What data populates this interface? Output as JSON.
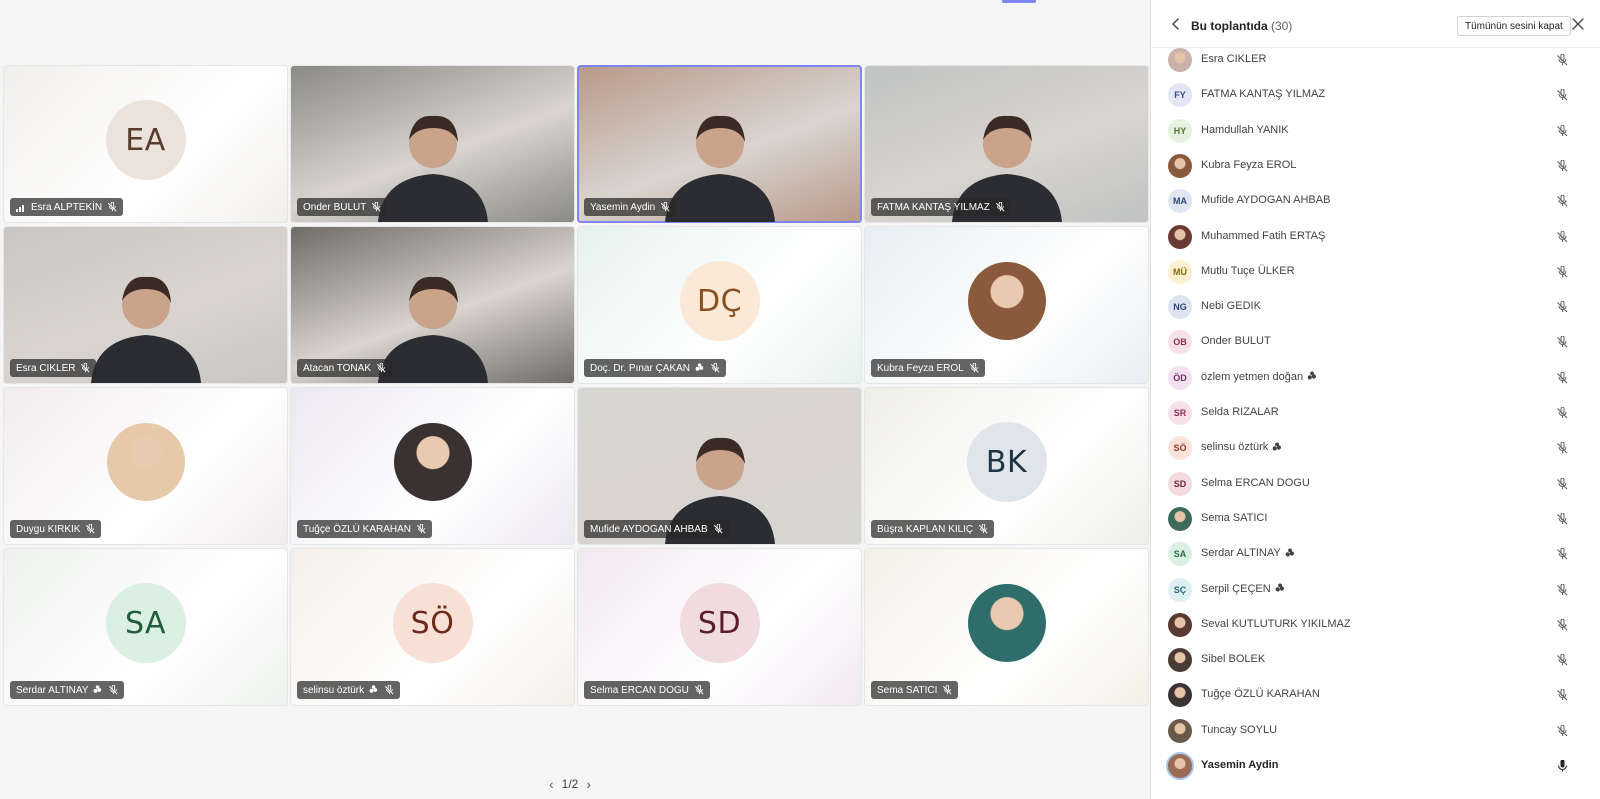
{
  "stage": {
    "tiles": [
      {
        "name": "Esra ALPTEKİN",
        "kind": "initials",
        "initials": "EA",
        "bg": "#f1efec",
        "avatar_bg": "#ece2dc",
        "avatar_fg": "#5a3c2e",
        "signal": true
      },
      {
        "name": "Onder BULUT",
        "kind": "video",
        "bg": "#8b8a86"
      },
      {
        "name": "Yasemin Aydin",
        "kind": "video",
        "bg": "#b99a8a",
        "active": true
      },
      {
        "name": "FATMA KANTAŞ YILMAZ",
        "kind": "video",
        "bg": "#bfc3c2"
      },
      {
        "name": "Esra CIKLER",
        "kind": "video",
        "bg": "#c9c6c4"
      },
      {
        "name": "Atacan TONAK",
        "kind": "video",
        "bg": "#6f6b66"
      },
      {
        "name": "Doç. Dr. Pınar ÇAKAN",
        "kind": "initials",
        "initials": "DÇ",
        "bg": "#e6f2ef",
        "avatar_bg": "#fbe9d7",
        "avatar_fg": "#8a4f1e",
        "hand": true
      },
      {
        "name": "Kubra Feyza EROL",
        "kind": "photo",
        "bg": "#e8eef2",
        "photo_color": "#8b5a3c"
      },
      {
        "name": "Duygu KIRKIK",
        "kind": "photo",
        "bg": "#f1ecef",
        "photo_color": "#e6c9a8"
      },
      {
        "name": "Tuğçe ÖZLÜ KARAHAN",
        "kind": "photo",
        "bg": "#ece8f1",
        "photo_color": "#3a3230"
      },
      {
        "name": "Mufide AYDOGAN AHBAB",
        "kind": "video",
        "bg": "#d8d6d2"
      },
      {
        "name": "Büşra KAPLAN KILIÇ",
        "kind": "initials",
        "initials": "BK",
        "bg": "#efeee9",
        "avatar_bg": "#dfe5ea",
        "avatar_fg": "#1f3444"
      },
      {
        "name": "Serdar ALTINAY",
        "kind": "initials",
        "initials": "SA",
        "bg": "#eef1ee",
        "avatar_bg": "#dcefe3",
        "avatar_fg": "#1f5d3b",
        "hand": true
      },
      {
        "name": "selinsu öztürk",
        "kind": "initials",
        "initials": "SÖ",
        "bg": "#f4efe9",
        "avatar_bg": "#f9e0d6",
        "avatar_fg": "#6b2a1a",
        "hand": true
      },
      {
        "name": "Selma ERCAN DOGU",
        "kind": "initials",
        "initials": "SD",
        "bg": "#f1e9f1",
        "avatar_bg": "#f0dcdf",
        "avatar_fg": "#5a1f2a"
      },
      {
        "name": "Sema SATICI",
        "kind": "photo",
        "bg": "#f3f0e6",
        "photo_color": "#2f6d6a"
      }
    ],
    "pager": {
      "label": "1/2"
    }
  },
  "panel": {
    "title": "Bu toplantıda",
    "count": "(30)",
    "mute_all_label": "Tümünün sesini kapat",
    "participants": [
      {
        "name": "Esra CIKLER",
        "initials": "",
        "photo": true,
        "color": "#c7b3a9",
        "partial": true
      },
      {
        "name": "FATMA KANTAŞ YILMAZ",
        "initials": "FY",
        "color": "#e2e6f5",
        "fg": "#3b4d8f"
      },
      {
        "name": "Hamdullah YANIK",
        "initials": "HY",
        "color": "#e7f1df",
        "fg": "#4f7a2e"
      },
      {
        "name": "Kubra Feyza EROL",
        "initials": "",
        "photo": true,
        "color": "#8b5a3c"
      },
      {
        "name": "Mufide AYDOGAN AHBAB",
        "initials": "MA",
        "color": "#dfe5f1",
        "fg": "#2c4a7a"
      },
      {
        "name": "Muhammed Fatih ERTAŞ",
        "initials": "",
        "photo": true,
        "color": "#6c3a34"
      },
      {
        "name": "Mutlu Tuçe ÜLKER",
        "initials": "MÜ",
        "color": "#fbf0cf",
        "fg": "#8c6a10"
      },
      {
        "name": "Nebi GEDIK",
        "initials": "NG",
        "color": "#dde3f0",
        "fg": "#2e4677"
      },
      {
        "name": "Onder BULUT",
        "initials": "OB",
        "color": "#f8e1e6",
        "fg": "#8f2e4a"
      },
      {
        "name": "özlem yetmen doğan",
        "initials": "ÖD",
        "color": "#f3e1ef",
        "fg": "#7a2d67",
        "hand": true
      },
      {
        "name": "Selda RIZALAR",
        "initials": "SR",
        "color": "#f6e1e8",
        "fg": "#8f3055"
      },
      {
        "name": "selinsu öztürk",
        "initials": "SÖ",
        "color": "#fbe3da",
        "fg": "#8f3a1f",
        "hand": true
      },
      {
        "name": "Selma ERCAN DOGU",
        "initials": "SD",
        "color": "#f0dcdf",
        "fg": "#6b2a36"
      },
      {
        "name": "Sema SATICI",
        "initials": "",
        "photo": true,
        "color": "#3d6b5a"
      },
      {
        "name": "Serdar ALTINAY",
        "initials": "SA",
        "color": "#dcefe3",
        "fg": "#2a6b43",
        "hand": true
      },
      {
        "name": "Serpil ÇEÇEN",
        "initials": "SÇ",
        "color": "#dff0f3",
        "fg": "#2a6a7a",
        "hand": true
      },
      {
        "name": "Seval KUTLUTURK YIKILMAZ",
        "initials": "",
        "photo": true,
        "color": "#5a3a30"
      },
      {
        "name": "Sibel BOLEK",
        "initials": "",
        "photo": true,
        "color": "#4a3b36"
      },
      {
        "name": "Tuğçe ÖZLÜ KARAHAN",
        "initials": "",
        "photo": true,
        "color": "#3c3432"
      },
      {
        "name": "Tuncay SOYLU",
        "initials": "",
        "photo": true,
        "color": "#6a5a4c"
      },
      {
        "name": "Yasemin Aydin",
        "initials": "",
        "photo": true,
        "color": "#9a6a52",
        "self": true
      }
    ]
  }
}
